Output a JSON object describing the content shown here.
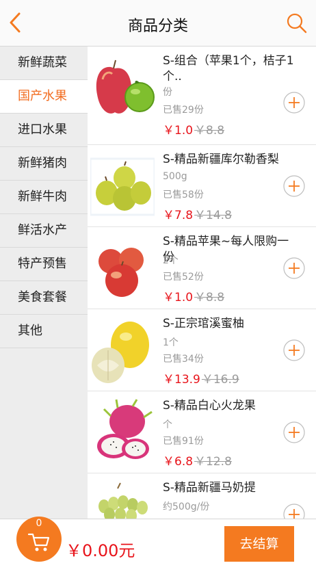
{
  "header": {
    "title": "商品分类",
    "back_icon": "chevron-left-icon",
    "search_icon": "search-icon",
    "accent_color": "#f47a20"
  },
  "sidebar": {
    "items": [
      {
        "label": "新鲜蔬菜",
        "active": false
      },
      {
        "label": "国产水果",
        "active": true
      },
      {
        "label": "进口水果",
        "active": false
      },
      {
        "label": "新鲜猪肉",
        "active": false
      },
      {
        "label": "新鲜牛肉",
        "active": false
      },
      {
        "label": "鲜活水产",
        "active": false
      },
      {
        "label": "特产预售",
        "active": false
      },
      {
        "label": "美食套餐",
        "active": false
      },
      {
        "label": "其他",
        "active": false
      }
    ]
  },
  "products": [
    {
      "name": "S-组合（苹果1个，桔子1个..",
      "unit": "份",
      "sold": "已售29份",
      "price": "￥1.0",
      "original_price": "￥8.8",
      "image": "apple-and-orange"
    },
    {
      "name": "S-精品新疆库尔勒香梨",
      "unit": "500g",
      "sold": "已售58份",
      "price": "￥7.8",
      "original_price": "￥14.8",
      "image": "pears"
    },
    {
      "name": "S-精品苹果~每人限购一份",
      "unit": "2个",
      "sold": "已售52份",
      "price": "￥1.0",
      "original_price": "￥8.8",
      "image": "red-apples"
    },
    {
      "name": "S-正宗琯溪蜜柚",
      "unit": "1个",
      "sold": "已售34份",
      "price": "￥13.9",
      "original_price": "￥16.9",
      "image": "pomelo"
    },
    {
      "name": "S-精品白心火龙果",
      "unit": "个",
      "sold": "已售91份",
      "price": "￥6.8",
      "original_price": "￥12.8",
      "image": "dragon-fruit"
    },
    {
      "name": "S-精品新疆马奶提",
      "unit": "约500g/份",
      "sold": "",
      "price": "",
      "original_price": "",
      "image": "grapes"
    }
  ],
  "footer": {
    "cart_count": "0",
    "total": "￥0.00元",
    "checkout_label": "去结算",
    "cart_icon": "shopping-cart-icon"
  }
}
